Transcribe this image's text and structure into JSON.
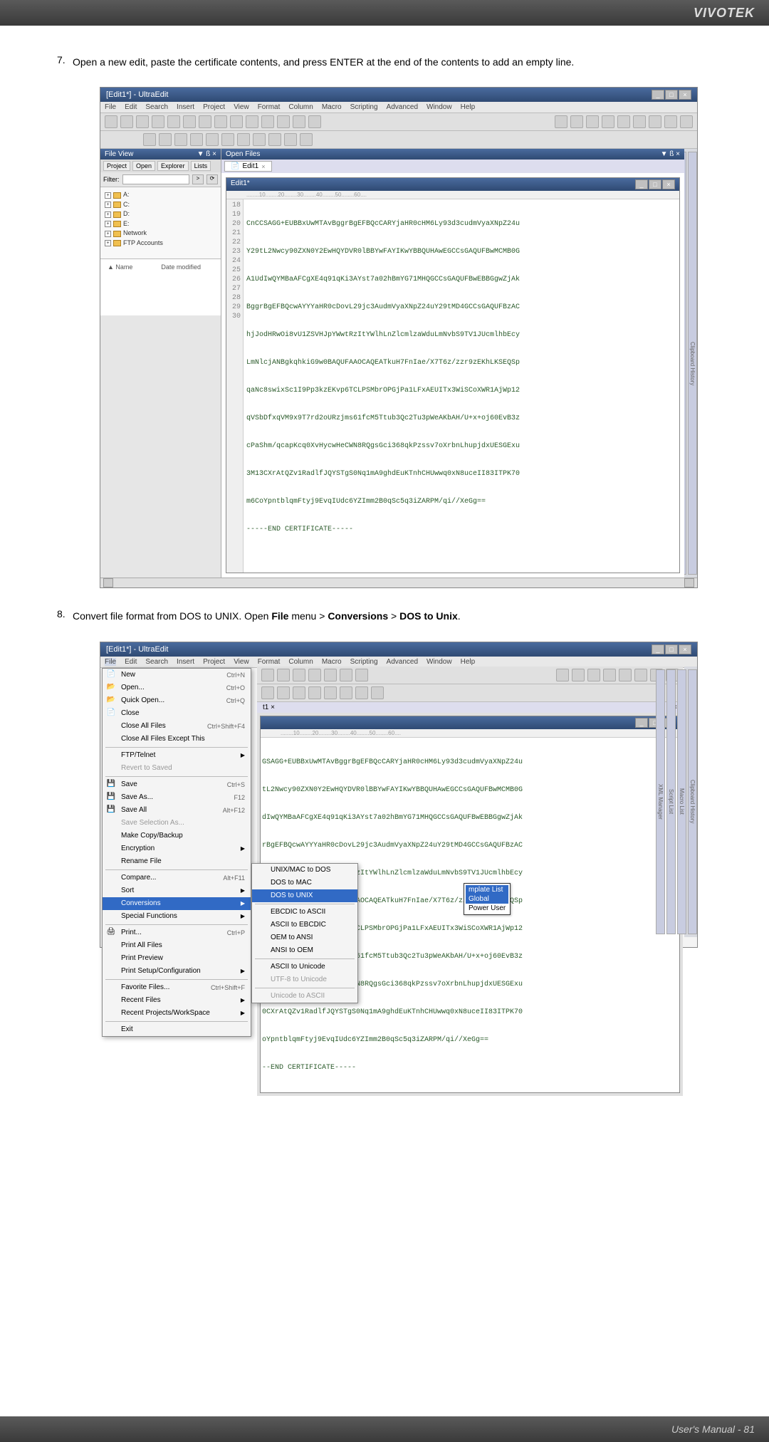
{
  "header": {
    "brand": "VIVOTEK"
  },
  "steps": {
    "s7": {
      "num": "7.",
      "text": "Open a new edit, paste the certificate contents, and press ENTER at the end of the contents to add an empty line."
    },
    "s8": {
      "num": "8.",
      "text_pre": "Convert file format from DOS to UNIX. Open ",
      "b1": "File",
      "mid1": " menu > ",
      "b2": "Conversions",
      "mid2": " > ",
      "b3": "DOS to Unix",
      "end": "."
    }
  },
  "win": {
    "title": "[Edit1*] - UltraEdit",
    "min": "_",
    "max": "□",
    "close": "×",
    "menus": [
      "File",
      "Edit",
      "Search",
      "Insert",
      "Project",
      "View",
      "Format",
      "Column",
      "Macro",
      "Scripting",
      "Advanced",
      "Window",
      "Help"
    ],
    "fileview_hdr": "File View",
    "close_x": "×",
    "dropdown": "▼  ß  ×",
    "openfiles_hdr": "Open Files",
    "openfiles_drop": "▼  ß  ×",
    "tabs": [
      "Project",
      "Open",
      "Explorer",
      "Lists"
    ],
    "filter_lbl": "Filter:",
    "go_btn": ">",
    "refresh_btn": "⟳",
    "tree": [
      {
        "exp": "+",
        "label": "A:"
      },
      {
        "exp": "+",
        "label": "C:"
      },
      {
        "exp": "+",
        "label": "D:"
      },
      {
        "exp": "+",
        "label": "E:"
      },
      {
        "exp": "+",
        "label": "Network"
      },
      {
        "exp": "+",
        "label": "FTP Accounts"
      }
    ],
    "list_hdrs": [
      "▲  Name",
      "Date modified"
    ],
    "tab_name": "Edit1",
    "doc_title": "Edit1*",
    "ruler": "........10........20........30........40........50........60....",
    "code_lines": [
      "CnCCSAGG+EUBBxUwMTAvBggrBgEFBQcCARYjaHR0cHM6Ly93d3cudmVyaXNpZ24u",
      "Y29tL2Nwcy90ZXN0Y2EwHQYDVR0lBBYwFAYIKwYBBQUHAwEGCCsGAQUFBwMCMB0G",
      "A1UdIwQYMBaAFCgXE4q91qKi3AYst7a02hBmYG71MHQGCCsGAQUFBwEBBGgwZjAk",
      "BggrBgEFBQcwAYYYaHR0cDovL29jc3AudmVyaXNpZ24uY29tMD4GCCsGAQUFBzAC",
      "hjJodHRwOi8vU1ZSVHJpYWwtRzItYWlhLnZlcmlzaWduLmNvbS9TV1JUcmlhbEcy",
      "LmNlcjANBgkqhkiG9w0BAQUFAAOCAQEATkuH7FnIae/X7T6z/zzr9zEKhLKSEQSp",
      "qaNc8swixSc1I9Pp3kzEKvp6TCLPSMbrOPGjPa1LFxAEUITx3WiSCoXWR1AjWp12",
      "qVSbDfxqVM9x9T7rd2oURzjms61fcM5Ttub3Qc2Tu3pWeAKbAH/U+x+oj60EvB3z",
      "cPaShm/qcapKcq0XvHycwHeCWN8RQgsGci368qkPzssv7oXrbnLhupjdxUESGExu",
      "3M13CXrAtQZv1RadlfJQYSTgS0Nq1mA9ghdEuKTnhCHUwwq0xN8uceII83ITPK70",
      "m6CoYpntblqmFtyj9EvqIUdc6YZImm2B0qSc5q3iZARPM/qi//XeGg==",
      "-----END CERTIFICATE-----",
      ""
    ],
    "gutter": [
      "18",
      "19",
      "20",
      "21",
      "22",
      "23",
      "24",
      "25",
      "26",
      "27",
      "28",
      "29",
      "30"
    ],
    "right_tabs": [
      "Clipboard History",
      "Macro List",
      "Script List",
      "XML Manager"
    ]
  },
  "win2": {
    "code_lines": [
      "GSAGG+EUBBxUwMTAvBggrBgEFBQcCARYjaHR0cHM6Ly93d3cudmVyaXNpZ24u",
      "tL2Nwcy90ZXN0Y2EwHQYDVR0lBBYwFAYIKwYBBQUHAwEGCCsGAQUFBwMCMB0G",
      "dIwQYMBaAFCgXE4q91qKi3AYst7a02hBmYG71MHQGCCsGAQUFBwEBBGgwZjAk",
      "rBgEFBQcwAYYYaHR0cDovL29jc3AudmVyaXNpZ24uY29tMD4GCCsGAQUFBzAC",
      "odHRwOi8vU1ZSVHJpYWwtRzItYWlhLnZlcmlzaWduLmNvbS9TV1JUcmlhbEcy",
      "lcjANBgkqhkiG9w0BAQUFAAOCAQEATkuH7FnIae/X7T6z/zzr9zEKhLKSEQSp",
      "c8swixSc1I9Pp3kzEKvp6TCLPSMbrOPGjPa1LFxAEUITx3WiSCoXWR1AjWp12",
      "bDfxqVM9x9T7rd2oURzjms61fcM5Ttub3Qc2Tu3pWeAKbAH/U+x+oj60EvB3z",
      "Shm/qcapKcq0XvHycwHeCWN8RQgsGci368qkPzssv7oXrbnLhupjdxUESGExu",
      "0CXrAtQZv1RadlfJQYSTgS0Nq1mA9ghdEuKTnhCHUwwq0xN8uceII83ITPK70",
      "oYpntblqmFtyj9EvqIUdc6YZImm2B0qSc5q3iZARPM/qi//XeGg==",
      "--END CERTIFICATE-----"
    ],
    "tab_name": "t1"
  },
  "filemenu": {
    "items": [
      {
        "label": "New",
        "sc": "Ctrl+N",
        "icon": "📄"
      },
      {
        "label": "Open...",
        "sc": "Ctrl+O",
        "icon": "📂"
      },
      {
        "label": "Quick Open...",
        "sc": "Ctrl+Q",
        "icon": "📂"
      },
      {
        "label": "Close",
        "sc": "",
        "icon": "📄"
      },
      {
        "label": "Close All Files",
        "sc": "Ctrl+Shift+F4",
        "icon": ""
      },
      {
        "label": "Close All Files Except This",
        "sc": "",
        "icon": ""
      },
      {
        "sep": true
      },
      {
        "label": "FTP/Telnet",
        "arr": true,
        "icon": ""
      },
      {
        "label": "Revert to Saved",
        "dis": true,
        "icon": ""
      },
      {
        "sep": true
      },
      {
        "label": "Save",
        "sc": "Ctrl+S",
        "icon": "💾"
      },
      {
        "label": "Save As...",
        "sc": "F12",
        "icon": "💾"
      },
      {
        "label": "Save All",
        "sc": "Alt+F12",
        "icon": "💾"
      },
      {
        "label": "Save Selection As...",
        "dis": true,
        "icon": ""
      },
      {
        "label": "Make Copy/Backup",
        "icon": ""
      },
      {
        "label": "Encryption",
        "arr": true,
        "icon": ""
      },
      {
        "label": "Rename File",
        "icon": ""
      },
      {
        "sep": true
      },
      {
        "label": "Compare...",
        "sc": "Alt+F11",
        "icon": ""
      },
      {
        "label": "Sort",
        "arr": true,
        "icon": ""
      },
      {
        "label": "Conversions",
        "arr": true,
        "sel": true,
        "icon": ""
      },
      {
        "label": "Special Functions",
        "arr": true,
        "icon": ""
      },
      {
        "sep": true
      },
      {
        "label": "Print...",
        "sc": "Ctrl+P",
        "icon": "🖨"
      },
      {
        "label": "Print All Files",
        "icon": ""
      },
      {
        "label": "Print Preview",
        "icon": ""
      },
      {
        "label": "Print Setup/Configuration",
        "arr": true,
        "icon": ""
      },
      {
        "sep": true
      },
      {
        "label": "Favorite Files...",
        "sc": "Ctrl+Shift+F",
        "icon": ""
      },
      {
        "label": "Recent Files",
        "arr": true,
        "icon": ""
      },
      {
        "label": "Recent Projects/WorkSpace",
        "arr": true,
        "icon": ""
      },
      {
        "sep": true
      },
      {
        "label": "Exit",
        "icon": ""
      }
    ]
  },
  "submenu": {
    "items": [
      {
        "label": "UNIX/MAC to DOS",
        "icon": ""
      },
      {
        "label": "DOS to MAC",
        "icon": ""
      },
      {
        "label": "DOS to UNIX",
        "sel": true,
        "icon": ""
      },
      {
        "sep": true
      },
      {
        "label": "EBCDIC to ASCII",
        "icon": ""
      },
      {
        "label": "ASCII to EBCDIC",
        "icon": ""
      },
      {
        "label": "OEM to ANSI",
        "icon": ""
      },
      {
        "label": "ANSI to OEM",
        "icon": ""
      },
      {
        "sep": true
      },
      {
        "label": "ASCII to Unicode",
        "icon": ""
      },
      {
        "label": "UTF-8 to Unicode",
        "dis": true,
        "icon": ""
      },
      {
        "sep": true
      },
      {
        "label": "Unicode to ASCII",
        "dis": true,
        "icon": ""
      }
    ]
  },
  "tooltip": {
    "hdr1": "mplate List",
    "hdr2": "Global",
    "line": "Power User"
  },
  "footer": {
    "text": "User's Manual - 81"
  }
}
